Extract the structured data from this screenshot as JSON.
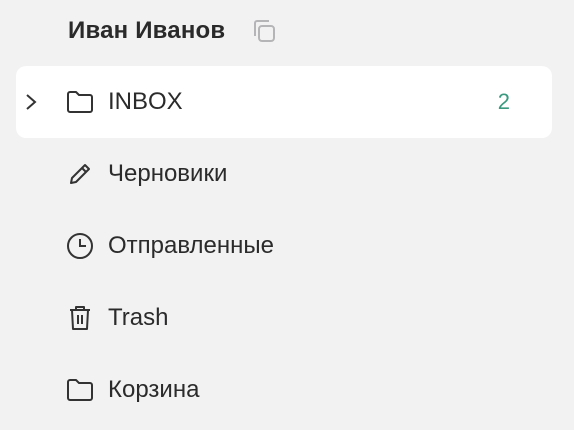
{
  "account": {
    "name": "Иван Иванов",
    "copy_icon": "copy-icon"
  },
  "folders": [
    {
      "label": "INBOX",
      "icon": "folder-icon",
      "count": "2",
      "active": true,
      "expandable": true
    },
    {
      "label": "Черновики",
      "icon": "pencil-icon"
    },
    {
      "label": "Отправленные",
      "icon": "clock-icon"
    },
    {
      "label": "Trash",
      "icon": "trash-icon"
    },
    {
      "label": "Корзина",
      "icon": "folder-icon"
    }
  ],
  "colors": {
    "background": "#f2f2f3",
    "active_background": "#ffffff",
    "count": "#3a9a80",
    "text": "#2b2b2b"
  }
}
